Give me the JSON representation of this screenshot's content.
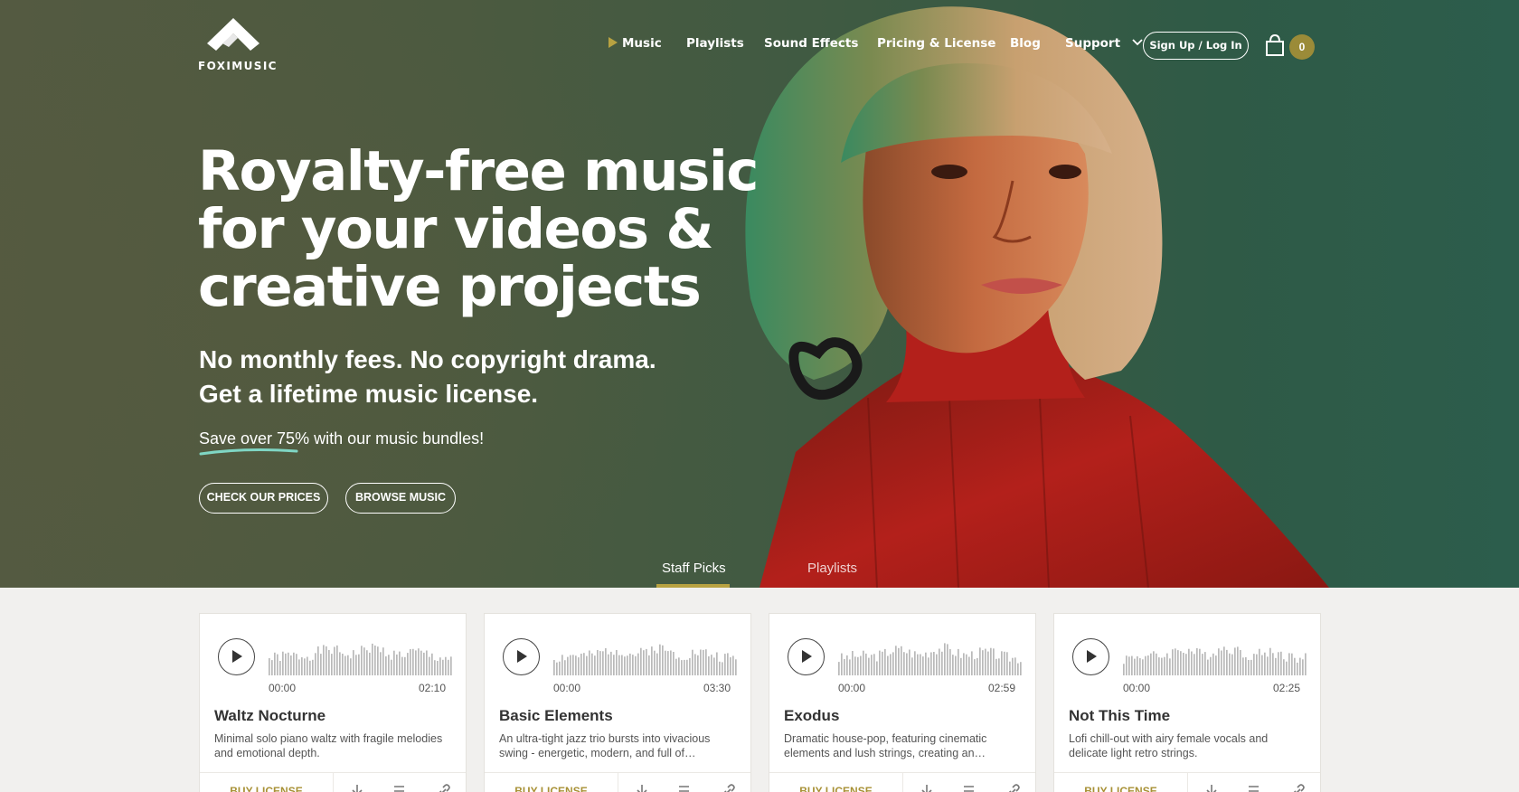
{
  "brand": {
    "name": "FOXIMUSIC"
  },
  "nav": {
    "items": [
      {
        "label": "Music",
        "active": true
      },
      {
        "label": "Playlists"
      },
      {
        "label": "Sound Effects"
      },
      {
        "label": "Pricing & License"
      },
      {
        "label": "Blog"
      },
      {
        "label": "Support"
      }
    ],
    "signup_label": "Sign Up / Log In",
    "cart_count": "0"
  },
  "hero": {
    "headline_lines": [
      "Royalty-free music",
      "for your videos &",
      "creative projects"
    ],
    "sub_lines": [
      "No monthly fees. No copyright drama.",
      "Get a lifetime music license."
    ],
    "save_highlight": "Save over 75%",
    "save_rest": " with our music bundles!",
    "buttons": {
      "prices": "CHECK OUR PRICES",
      "browse": "BROWSE MUSIC"
    }
  },
  "tabs": {
    "staff_picks": "Staff Picks",
    "playlists": "Playlists",
    "active": "Staff Picks"
  },
  "tracks": [
    {
      "title": "Waltz Nocturne",
      "start": "00:00",
      "end": "02:10",
      "desc": "Minimal solo piano waltz with fragile melodies and emotional depth."
    },
    {
      "title": "Basic Elements",
      "start": "00:00",
      "end": "03:30",
      "desc": "An ultra-tight jazz trio bursts into vivacious swing - energetic, modern, and full of…"
    },
    {
      "title": "Exodus",
      "start": "00:00",
      "end": "02:59",
      "desc": "Dramatic house-pop, featuring cinematic elements and lush strings, creating an…"
    },
    {
      "title": "Not This Time",
      "start": "00:00",
      "end": "02:25",
      "desc": "Lofi chill-out with airy female vocals and delicate light retro strings."
    }
  ],
  "card_actions": {
    "buy_label": "BUY LICENSE",
    "icons": [
      "download-icon",
      "add-to-playlist-icon",
      "link-icon"
    ]
  },
  "colors": {
    "accent": "#b8a241",
    "hero_bg": "#3f5a42",
    "sweater": "#b3201b"
  }
}
